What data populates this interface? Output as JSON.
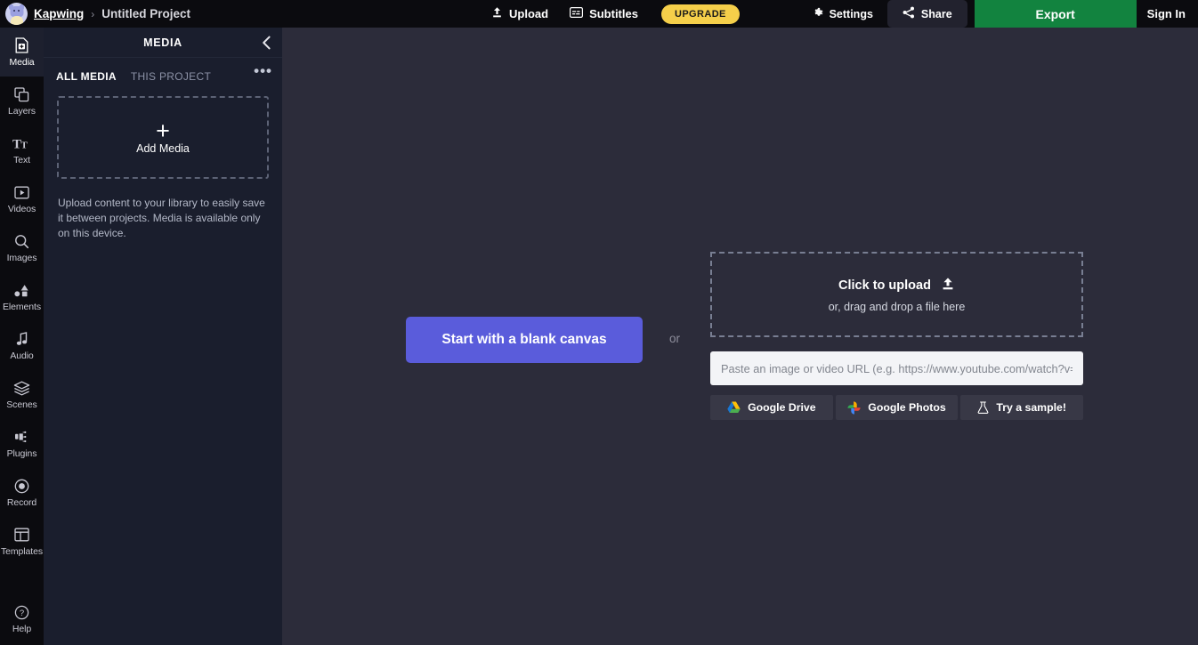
{
  "topbar": {
    "brand": "Kapwing",
    "separator": "›",
    "project_name": "Untitled Project",
    "upload_label": "Upload",
    "subtitles_label": "Subtitles",
    "upgrade_label": "UPGRADE",
    "settings_label": "Settings",
    "share_label": "Share",
    "export_label": "Export",
    "signin_label": "Sign In"
  },
  "rail": {
    "items": [
      {
        "label": "Media",
        "icon": "media-icon",
        "active": true
      },
      {
        "label": "Layers",
        "icon": "layers-icon",
        "active": false
      },
      {
        "label": "Text",
        "icon": "text-icon",
        "active": false
      },
      {
        "label": "Videos",
        "icon": "videos-icon",
        "active": false
      },
      {
        "label": "Images",
        "icon": "images-icon",
        "active": false
      },
      {
        "label": "Elements",
        "icon": "elements-icon",
        "active": false
      },
      {
        "label": "Audio",
        "icon": "audio-icon",
        "active": false
      },
      {
        "label": "Scenes",
        "icon": "scenes-icon",
        "active": false
      },
      {
        "label": "Plugins",
        "icon": "plugins-icon",
        "active": false
      },
      {
        "label": "Record",
        "icon": "record-icon",
        "active": false
      },
      {
        "label": "Templates",
        "icon": "templates-icon",
        "active": false
      }
    ],
    "help_label": "Help",
    "help_icon": "question-circle-icon"
  },
  "panel": {
    "title": "MEDIA",
    "collapse_icon": "chevron-left-icon",
    "more_icon": "ellipsis-icon",
    "more_label": "•••",
    "tabs": [
      {
        "label": "ALL MEDIA",
        "active": true
      },
      {
        "label": "THIS PROJECT",
        "active": false
      }
    ],
    "add_media_plus": "+",
    "add_media_label": "Add Media",
    "hint": "Upload content to your library to easily save it between projects. Media is available only on this device."
  },
  "main": {
    "start_button_label": "Start with a blank canvas",
    "or_label": "or",
    "dropzone": {
      "title": "Click to upload",
      "upload_icon": "upload-arrow-icon",
      "subtitle": "or, drag and drop a file here"
    },
    "url_input_placeholder": "Paste an image or video URL (e.g. https://www.youtube.com/watch?v=C",
    "url_input_value": "",
    "providers": [
      {
        "label": "Google Drive",
        "icon": "google-drive-icon"
      },
      {
        "label": "Google Photos",
        "icon": "google-photos-icon"
      },
      {
        "label": "Try a sample!",
        "icon": "flask-icon"
      }
    ]
  },
  "colors": {
    "topbar_bg": "#0b0b0f",
    "panel_bg": "#1a1e2d",
    "canvas_bg": "#2c2c3a",
    "accent_purple": "#5a5cdb",
    "accent_green": "#12833f",
    "accent_yellow": "#f5cf4a"
  }
}
